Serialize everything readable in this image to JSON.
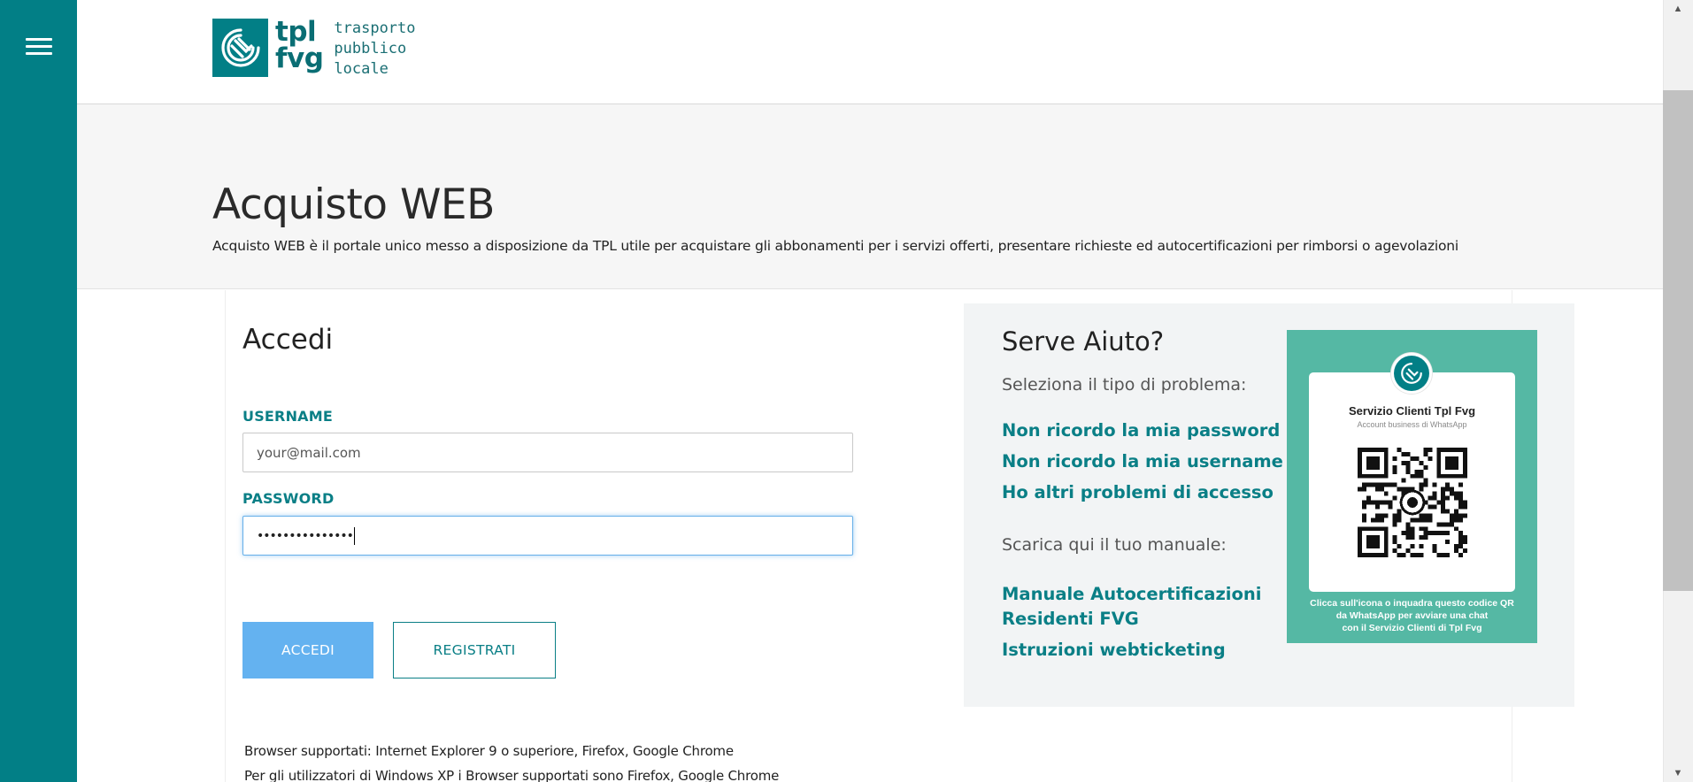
{
  "sidebar": {
    "menu_icon": "hamburger-menu-icon"
  },
  "header": {
    "logo": {
      "mark_icon": "tpl-fvg-logo-icon",
      "line1": "tpl",
      "line2": "fvg",
      "sub1": "trasporto",
      "sub2": "pubblico",
      "sub3": "locale"
    }
  },
  "hero": {
    "title": "Acquisto WEB",
    "description": "Acquisto WEB è il portale unico messo a disposizione da TPL utile per acquistare gli abbonamenti per i servizi offerti, presentare richieste ed autocertificazioni per rimborsi o agevolazioni"
  },
  "login": {
    "title": "Accedi",
    "username_label": "USERNAME",
    "username_placeholder": "your@mail.com",
    "password_label": "PASSWORD",
    "password_value": "•••••••••••••••",
    "accedi_label": "ACCEDI",
    "registrati_label": "REGISTRATI"
  },
  "help": {
    "title": "Serve Aiuto?",
    "problem_prompt": "Seleziona il tipo di problema:",
    "links": [
      "Non ricordo la mia password",
      "Non ricordo la mia username",
      "Ho altri problemi di accesso"
    ],
    "manual_prompt": "Scarica qui il tuo manuale:",
    "manual_link_line1": "Manuale Autocertificazioni",
    "manual_link_line2": "Residenti FVG",
    "webticketing_link": "Istruzioni webticketing",
    "whatsapp": {
      "title": "Servizio Clienti Tpl Fvg",
      "subtitle": "Account business di WhatsApp",
      "caption_line1": "Clicca sull'icona o inquadra questo codice QR",
      "caption_line2": "da WhatsApp per avviare una chat",
      "caption_line3": "con il Servizio Clienti di Tpl Fvg",
      "panel_color": "#55b8a4"
    }
  },
  "footer": {
    "line1": "Browser supportati: Internet Explorer 9 o superiore, Firefox, Google Chrome",
    "line2": "Per gli utilizzatori di Windows XP i Browser supportati sono Firefox, Google Chrome"
  },
  "colors": {
    "brand_teal": "#027f86",
    "link_teal": "#0a7f86",
    "accedi_blue": "#64b2f0"
  }
}
